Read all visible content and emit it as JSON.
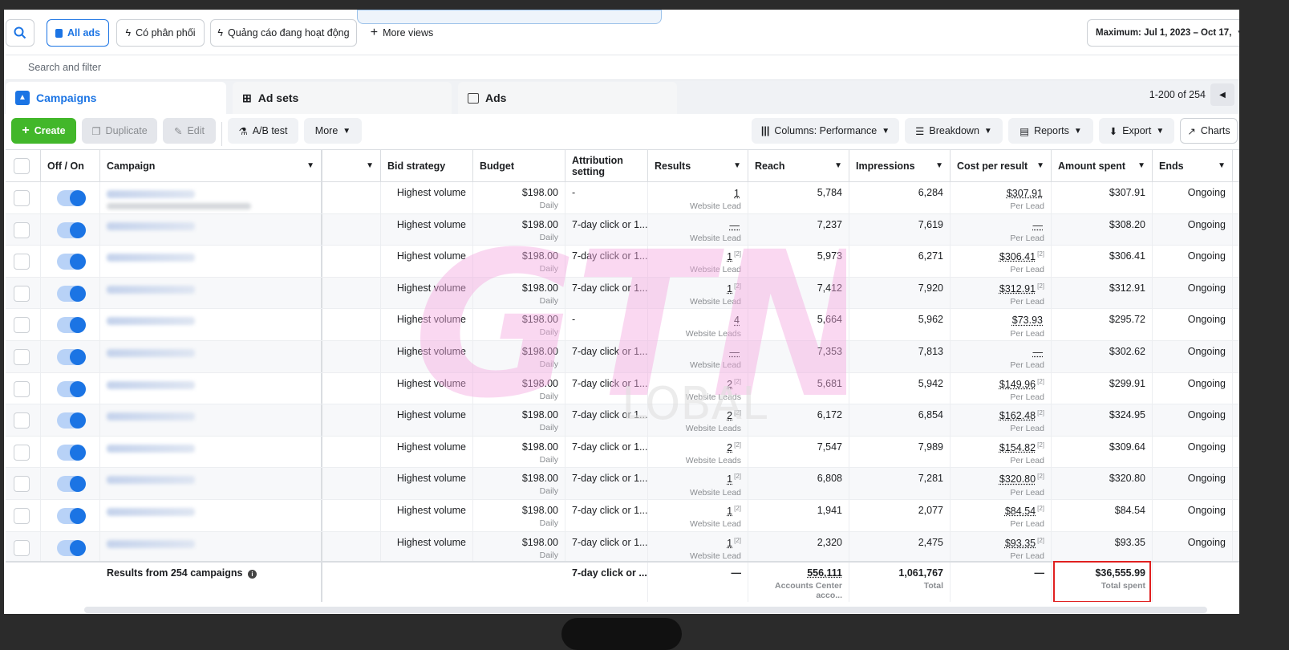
{
  "topbar": {
    "all_ads": "All ads",
    "view1": "Có phân phối",
    "view2": "Quảng cáo đang hoạt động",
    "more_views": "More views",
    "date_range": "Maximum: Jul 1, 2023 – Oct 17,"
  },
  "search": {
    "placeholder": "Search and filter"
  },
  "tabs": {
    "campaigns": "Campaigns",
    "ad_sets": "Ad sets",
    "ads": "Ads"
  },
  "pager": {
    "text": "1-200 of 254"
  },
  "toolbar": {
    "create": "Create",
    "duplicate": "Duplicate",
    "edit": "Edit",
    "ab_test": "A/B test",
    "more": "More",
    "columns": "Columns: Performance",
    "breakdown": "Breakdown",
    "reports": "Reports",
    "export": "Export",
    "charts": "Charts"
  },
  "headers": {
    "off_on": "Off / On",
    "campaign": "Campaign",
    "bid_strategy": "Bid strategy",
    "budget": "Budget",
    "attribution": "Attribution setting",
    "results": "Results",
    "reach": "Reach",
    "impressions": "Impressions",
    "cost_per_result": "Cost per result",
    "amount_spent": "Amount spent",
    "ends": "Ends"
  },
  "rows": [
    {
      "bid": "Highest volume",
      "budget": "$198.00",
      "budget_sub": "Daily",
      "attr": "-",
      "results": "1",
      "results_sup": "",
      "results_sub": "Website Lead",
      "reach": "5,784",
      "impr": "6,284",
      "cpr": "$307.91",
      "cpr_sup": "",
      "cpr_sub": "Per Lead",
      "spent": "$307.91",
      "ends": "Ongoing"
    },
    {
      "bid": "Highest volume",
      "budget": "$198.00",
      "budget_sub": "Daily",
      "attr": "7-day click or 1...",
      "results": "—",
      "results_sup": "",
      "results_sub": "Website Lead",
      "reach": "7,237",
      "impr": "7,619",
      "cpr": "—",
      "cpr_sup": "",
      "cpr_sub": "Per Lead",
      "spent": "$308.20",
      "ends": "Ongoing"
    },
    {
      "bid": "Highest volume",
      "budget": "$198.00",
      "budget_sub": "Daily",
      "attr": "7-day click or 1...",
      "results": "1",
      "results_sup": "[2]",
      "results_sub": "Website Lead",
      "reach": "5,973",
      "impr": "6,271",
      "cpr": "$306.41",
      "cpr_sup": "[2]",
      "cpr_sub": "Per Lead",
      "spent": "$306.41",
      "ends": "Ongoing"
    },
    {
      "bid": "Highest volume",
      "budget": "$198.00",
      "budget_sub": "Daily",
      "attr": "7-day click or 1...",
      "results": "1",
      "results_sup": "[2]",
      "results_sub": "Website Lead",
      "reach": "7,412",
      "impr": "7,920",
      "cpr": "$312.91",
      "cpr_sup": "[2]",
      "cpr_sub": "Per Lead",
      "spent": "$312.91",
      "ends": "Ongoing"
    },
    {
      "bid": "Highest volume",
      "budget": "$198.00",
      "budget_sub": "Daily",
      "attr": "-",
      "results": "4",
      "results_sup": "",
      "results_sub": "Website Leads",
      "reach": "5,664",
      "impr": "5,962",
      "cpr": "$73.93",
      "cpr_sup": "",
      "cpr_sub": "Per Lead",
      "spent": "$295.72",
      "ends": "Ongoing"
    },
    {
      "bid": "Highest volume",
      "budget": "$198.00",
      "budget_sub": "Daily",
      "attr": "7-day click or 1...",
      "results": "—",
      "results_sup": "",
      "results_sub": "Website Lead",
      "reach": "7,353",
      "impr": "7,813",
      "cpr": "—",
      "cpr_sup": "",
      "cpr_sub": "Per Lead",
      "spent": "$302.62",
      "ends": "Ongoing"
    },
    {
      "bid": "Highest volume",
      "budget": "$198.00",
      "budget_sub": "Daily",
      "attr": "7-day click or 1...",
      "results": "2",
      "results_sup": "[2]",
      "results_sub": "Website Leads",
      "reach": "5,681",
      "impr": "5,942",
      "cpr": "$149.96",
      "cpr_sup": "[2]",
      "cpr_sub": "Per Lead",
      "spent": "$299.91",
      "ends": "Ongoing"
    },
    {
      "bid": "Highest volume",
      "budget": "$198.00",
      "budget_sub": "Daily",
      "attr": "7-day click or 1...",
      "results": "2",
      "results_sup": "[2]",
      "results_sub": "Website Leads",
      "reach": "6,172",
      "impr": "6,854",
      "cpr": "$162.48",
      "cpr_sup": "[2]",
      "cpr_sub": "Per Lead",
      "spent": "$324.95",
      "ends": "Ongoing"
    },
    {
      "bid": "Highest volume",
      "budget": "$198.00",
      "budget_sub": "Daily",
      "attr": "7-day click or 1...",
      "results": "2",
      "results_sup": "[2]",
      "results_sub": "Website Leads",
      "reach": "7,547",
      "impr": "7,989",
      "cpr": "$154.82",
      "cpr_sup": "[2]",
      "cpr_sub": "Per Lead",
      "spent": "$309.64",
      "ends": "Ongoing"
    },
    {
      "bid": "Highest volume",
      "budget": "$198.00",
      "budget_sub": "Daily",
      "attr": "7-day click or 1...",
      "results": "1",
      "results_sup": "[2]",
      "results_sub": "Website Lead",
      "reach": "6,808",
      "impr": "7,281",
      "cpr": "$320.80",
      "cpr_sup": "[2]",
      "cpr_sub": "Per Lead",
      "spent": "$320.80",
      "ends": "Ongoing"
    },
    {
      "bid": "Highest volume",
      "budget": "$198.00",
      "budget_sub": "Daily",
      "attr": "7-day click or 1...",
      "results": "1",
      "results_sup": "[2]",
      "results_sub": "Website Lead",
      "reach": "1,941",
      "impr": "2,077",
      "cpr": "$84.54",
      "cpr_sup": "[2]",
      "cpr_sub": "Per Lead",
      "spent": "$84.54",
      "ends": "Ongoing"
    },
    {
      "bid": "Highest volume",
      "budget": "$198.00",
      "budget_sub": "Daily",
      "attr": "7-day click or 1...",
      "results": "1",
      "results_sup": "[2]",
      "results_sub": "Website Lead",
      "reach": "2,320",
      "impr": "2,475",
      "cpr": "$93.35",
      "cpr_sup": "[2]",
      "cpr_sub": "Per Lead",
      "spent": "$93.35",
      "ends": "Ongoing"
    }
  ],
  "footer": {
    "label": "Results from 254 campaigns",
    "attr": "7-day click or ...",
    "results": "—",
    "reach": "556,111",
    "reach_sub": "Accounts Center acco...",
    "impr": "1,061,767",
    "impr_sub": "Total",
    "cpr": "—",
    "spent": "$36,555.99",
    "spent_sub": "Total spent"
  },
  "watermark": {
    "text": "GTN",
    "subtext": "LOBAL"
  },
  "colors": {
    "accent": "#1b74e4",
    "create": "#42b72a",
    "highlight": "#e02020"
  }
}
